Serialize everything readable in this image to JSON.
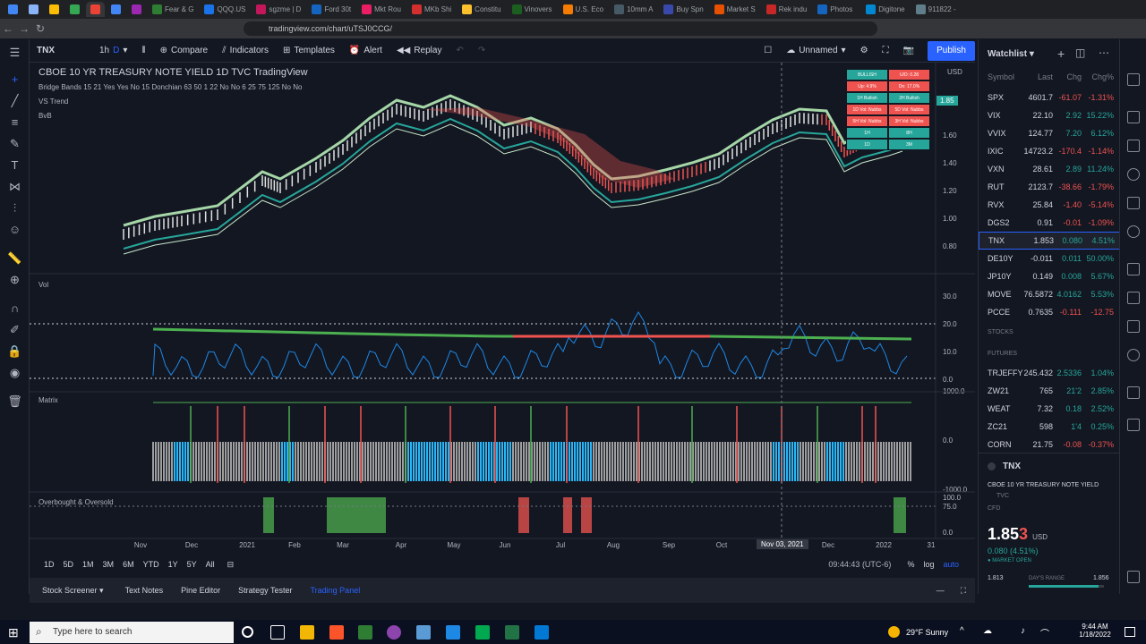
{
  "browser": {
    "tabs": [
      "",
      "",
      "",
      "",
      "",
      "",
      "",
      "Fear & G",
      "QQQ.US",
      "sgzme | D",
      "Ford 30t",
      "Mkt Rou",
      "MKb Shi",
      "Constitu",
      "Vinovers",
      "U.S. Eco",
      "10mm A",
      "Buy Spn",
      "Market S",
      "Rek indu",
      "Photos",
      "Digitone",
      "911822 -"
    ],
    "url": "tradingview.com/chart/uTSJ0CCG/"
  },
  "toolbar": {
    "symbol": "TNX",
    "interval": "1h",
    "d_label": "D",
    "compare": "Compare",
    "indicators": "Indicators",
    "templates": "Templates",
    "alert": "Alert",
    "replay": "Replay",
    "layout_name": "Unnamed",
    "publish": "Publish"
  },
  "chart": {
    "title": "CBOE 10 YR TREASURY NOTE YIELD  1D  TVC  TradingView",
    "study1": "Bridge Bands 15 21 Yes Yes No 15 Donchian 63 50 1 22 No No 6 25 75 125 No No",
    "study2": "VS Trend",
    "study3": "BvB",
    "currency": "USD",
    "price_tag": "1.85",
    "price_ticks": [
      "1.60",
      "1.40",
      "1.20",
      "1.00",
      "0.80"
    ],
    "vol_label": "Vol",
    "vol_ticks": [
      "30.0",
      "20.0",
      "10.0",
      "0.0"
    ],
    "matrix_label": "Matrix",
    "matrix_ticks": [
      "1000.0",
      "0.0",
      "-1000.0"
    ],
    "ob_label": "Overbought & Oversold",
    "ob_ticks": [
      "100.0",
      "75.0",
      "0.0"
    ],
    "x_ticks": [
      "Nov",
      "Dec",
      "2021",
      "Feb",
      "Mar",
      "Apr",
      "May",
      "Jun",
      "Jul",
      "Aug",
      "Sep",
      "Oct",
      "Nov 03, 2021",
      "Dec",
      "2022",
      "31"
    ],
    "time": "09:44:43 (UTC-6)",
    "ranges": [
      "1D",
      "5D",
      "1M",
      "3M",
      "6M",
      "YTD",
      "1Y",
      "5Y",
      "All"
    ],
    "scale_pct": "%",
    "scale_log": "log",
    "scale_auto": "auto",
    "table": [
      [
        "BULLISH",
        "U/D: 0.28"
      ],
      [
        "Up: 4.9%",
        "Dn: 17.0%"
      ],
      [
        "1H Bullish",
        "2H Bullish"
      ],
      [
        "1D Vol: Nubbs",
        "5D Vol: Nubbs"
      ],
      [
        "5H Vol: Nubbs",
        "3H Vol: Nubbs"
      ],
      [
        "1H",
        "8H"
      ],
      [
        "1D",
        "3M"
      ]
    ]
  },
  "bottom_tabs": [
    "Stock Screener",
    "Text Notes",
    "Pine Editor",
    "Strategy Tester",
    "Trading Panel"
  ],
  "watchlist": {
    "title": "Watchlist",
    "headers": [
      "Symbol",
      "Last",
      "Chg",
      "Chg%"
    ],
    "rows": [
      {
        "sym": "SPX",
        "last": "4601.7",
        "chg": "-61.07",
        "pct": "-1.31%",
        "up": false
      },
      {
        "sym": "VIX",
        "last": "22.10",
        "chg": "2.92",
        "pct": "15.22%",
        "up": true
      },
      {
        "sym": "VVIX",
        "last": "124.77",
        "chg": "7.20",
        "pct": "6.12%",
        "up": true
      },
      {
        "sym": "IXIC",
        "last": "14723.2",
        "chg": "-170.4",
        "pct": "-1.14%",
        "up": false
      },
      {
        "sym": "VXN",
        "last": "28.61",
        "chg": "2.89",
        "pct": "11.24%",
        "up": true
      },
      {
        "sym": "RUT",
        "last": "2123.7",
        "chg": "-38.66",
        "pct": "-1.79%",
        "up": false
      },
      {
        "sym": "RVX",
        "last": "25.84",
        "chg": "-1.40",
        "pct": "-5.14%",
        "up": false
      },
      {
        "sym": "DGS2",
        "last": "0.91",
        "chg": "-0.01",
        "pct": "-1.09%",
        "up": false
      },
      {
        "sym": "TNX",
        "last": "1.853",
        "chg": "0.080",
        "pct": "4.51%",
        "up": true
      },
      {
        "sym": "DE10Y",
        "last": "-0.011",
        "chg": "0.011",
        "pct": "50.00%",
        "up": true
      },
      {
        "sym": "JP10Y",
        "last": "0.149",
        "chg": "0.008",
        "pct": "5.67%",
        "up": true
      },
      {
        "sym": "MOVE",
        "last": "76.5872",
        "chg": "4.0162",
        "pct": "5.53%",
        "up": true
      },
      {
        "sym": "PCCE",
        "last": "0.7635",
        "chg": "-0.111",
        "pct": "-12.75",
        "up": false
      }
    ],
    "section_stocks": "STOCKS",
    "section_futures": "FUTURES",
    "futures": [
      {
        "sym": "TRJEFFY",
        "last": "245.432",
        "chg": "2.5336",
        "pct": "1.04%",
        "up": true
      },
      {
        "sym": "ZW21",
        "last": "765",
        "chg": "21'2",
        "pct": "2.85%",
        "up": true
      },
      {
        "sym": "WEAT",
        "last": "7.32",
        "chg": "0.18",
        "pct": "2.52%",
        "up": true
      },
      {
        "sym": "ZC21",
        "last": "598",
        "chg": "1'4",
        "pct": "0.25%",
        "up": true
      },
      {
        "sym": "CORN",
        "last": "21.75",
        "chg": "-0.08",
        "pct": "-0.37%",
        "up": false
      }
    ],
    "detail": {
      "sym": "TNX",
      "name": "CBOE 10 YR TREASURY NOTE YIELD",
      "exchange": "TVC",
      "type": "CFD",
      "price": "1.85",
      "price_small": "3",
      "currency": "USD",
      "change": "0.080 (4.51%)",
      "status": "MARKET OPEN",
      "low": "1.813",
      "range_label": "DAY'S RANGE",
      "high": "1.856"
    }
  },
  "taskbar": {
    "search": "Type here to search",
    "weather": "29°F  Sunny",
    "time": "9:44 AM",
    "date": "1/18/2022"
  }
}
